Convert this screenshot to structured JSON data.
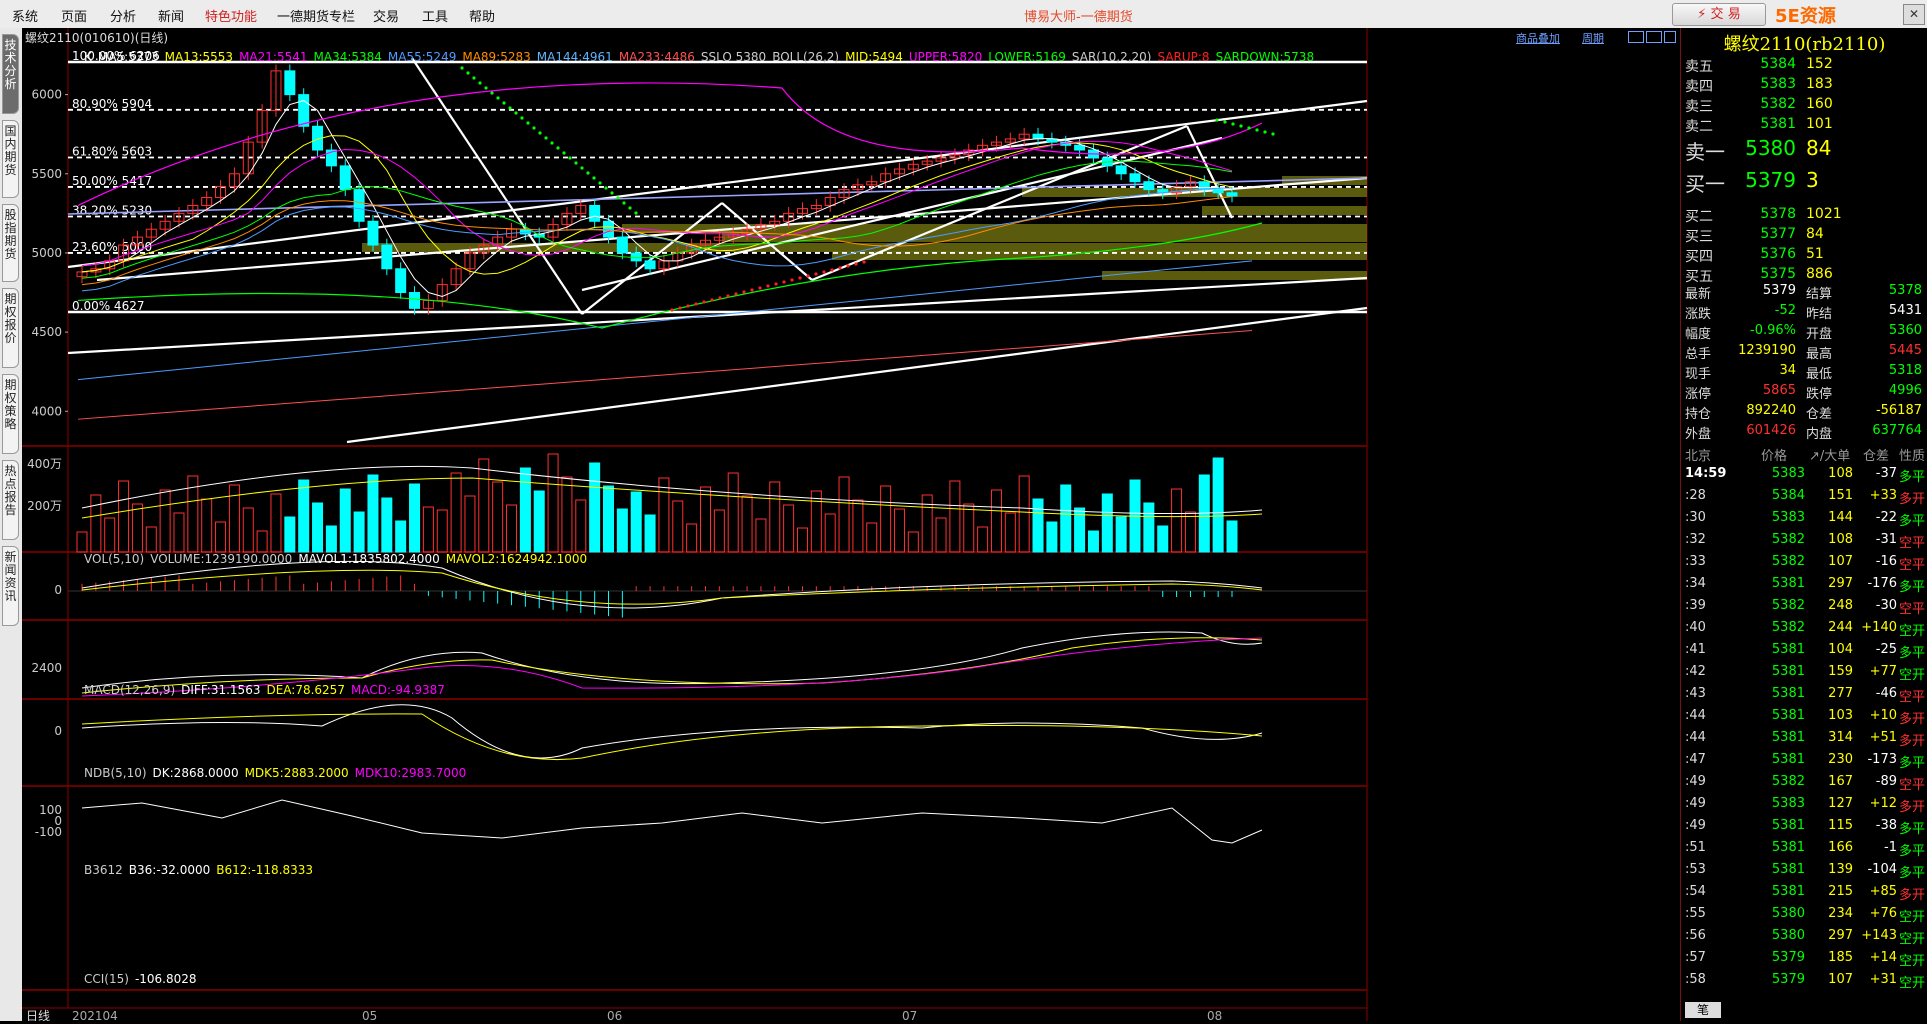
{
  "menu": [
    "系统",
    "页面",
    "分析",
    "新闻",
    "特色功能",
    "一德期货专栏",
    "交易",
    "工具",
    "帮助"
  ],
  "app_title": "博易大师-一德期货",
  "trade_label": "⚡ 交 易",
  "watermark": "5E资源5etz.com",
  "left_tabs": [
    "技术分析",
    "国内期货",
    "股指期货",
    "期权报价",
    "期权策略",
    "热点报告",
    "新闻资讯"
  ],
  "window_title": "螺纹2110(010610)(日线)",
  "top_links": [
    "商品叠加",
    "周期"
  ],
  "ma_legend": [
    {
      "t": "K",
      "c": "#ffffff"
    },
    {
      "t": "MA5:5373",
      "c": "#ffffff"
    },
    {
      "t": "MA13:5553",
      "c": "#ffff00"
    },
    {
      "t": "MA21:5541",
      "c": "#ff00ff"
    },
    {
      "t": "MA34:5384",
      "c": "#00ff00"
    },
    {
      "t": "MA55:5249",
      "c": "#4f9bff"
    },
    {
      "t": "MA89:5283",
      "c": "#ff8c00"
    },
    {
      "t": "MA144:4961",
      "c": "#5fb4ff"
    },
    {
      "t": "MA233:4486",
      "c": "#ff5050"
    },
    {
      "t": "SSLO 5380",
      "c": "#cccccc"
    },
    {
      "t": "BOLL(26,2)",
      "c": "#cccccc"
    },
    {
      "t": "MID:5494",
      "c": "#ffff00"
    },
    {
      "t": "UPPER:5820",
      "c": "#ff00ff"
    },
    {
      "t": "LOWER:5169",
      "c": "#00ff00"
    },
    {
      "t": "SAR(10,2,20)",
      "c": "#cccccc"
    },
    {
      "t": "SARUP:8",
      "c": "#ff2020"
    },
    {
      "t": "SARDOWN:5738",
      "c": "#00ff00"
    }
  ],
  "fib_labels": [
    "100.00% 6206",
    "80.90% 5904",
    "61.80% 5603",
    "50.00% 5417",
    "38.20% 5230",
    "23.60% 5000",
    "0.00% 4627"
  ],
  "price_axis": [
    "6000",
    "5500",
    "5000",
    "4500",
    "4000"
  ],
  "vol_legend": [
    {
      "t": "VOL(5,10)",
      "c": "#cccccc"
    },
    {
      "t": "VOLUME:1239190.0000",
      "c": "#cccccc"
    },
    {
      "t": "MAVOL1:1835802.4000",
      "c": "#ffffff"
    },
    {
      "t": "MAVOL2:1624942.1000",
      "c": "#ffff00"
    }
  ],
  "vol_axis": [
    "400万",
    "200万"
  ],
  "macd_legend": [
    {
      "t": "MACD(12,26,9)",
      "c": "#cccccc"
    },
    {
      "t": "DIFF:31.1563",
      "c": "#ffffff"
    },
    {
      "t": "DEA:78.6257",
      "c": "#ffff00"
    },
    {
      "t": "MACD:-94.9387",
      "c": "#ff00ff"
    }
  ],
  "macd_axis": [
    "0"
  ],
  "ndb_legend": [
    {
      "t": "NDB(5,10)",
      "c": "#cccccc"
    },
    {
      "t": "DK:2868.0000",
      "c": "#ffffff"
    },
    {
      "t": "MDK5:2883.2000",
      "c": "#ffff00"
    },
    {
      "t": "MDK10:2983.7000",
      "c": "#ff00ff"
    }
  ],
  "ndb_axis": [
    "2400"
  ],
  "b36_legend": [
    {
      "t": "B3612",
      "c": "#cccccc"
    },
    {
      "t": "B36:-32.0000",
      "c": "#ffffff"
    },
    {
      "t": "B612:-118.8333",
      "c": "#ffff00"
    }
  ],
  "b36_axis": [
    "0"
  ],
  "cci_legend": [
    {
      "t": "CCI(15)",
      "c": "#cccccc"
    },
    {
      "t": "-106.8028",
      "c": "#ffffff"
    }
  ],
  "cci_axis": [
    "100",
    "0",
    "-100"
  ],
  "date_axis": [
    "日线",
    "202104",
    "05",
    "06",
    "07",
    "08"
  ],
  "quote": {
    "title": "螺纹2110(rb2110)",
    "asks": [
      [
        "卖五",
        "5384",
        "152"
      ],
      [
        "卖四",
        "5383",
        "183"
      ],
      [
        "卖三",
        "5382",
        "160"
      ],
      [
        "卖二",
        "5381",
        "101"
      ],
      [
        "卖一",
        "5380",
        "84"
      ]
    ],
    "bids": [
      [
        "买一",
        "5379",
        "3"
      ],
      [
        "买二",
        "5378",
        "1021"
      ],
      [
        "买三",
        "5377",
        "84"
      ],
      [
        "买四",
        "5376",
        "51"
      ],
      [
        "买五",
        "5375",
        "886"
      ]
    ],
    "stats": [
      [
        "最新",
        "5379",
        "结算",
        "5378"
      ],
      [
        "涨跌",
        "-52",
        "昨结",
        "5431"
      ],
      [
        "幅度",
        "-0.96%",
        "开盘",
        "5360"
      ],
      [
        "总手",
        "1239190",
        "最高",
        "5445"
      ],
      [
        "现手",
        "34",
        "最低",
        "5318"
      ],
      [
        "涨停",
        "5865",
        "跌停",
        "4996"
      ],
      [
        "持仓",
        "892240",
        "仓差",
        "-56187"
      ],
      [
        "外盘",
        "601426",
        "内盘",
        "637764"
      ]
    ],
    "tick_header": [
      "北京",
      "价格",
      "↗/大单",
      "仓差",
      "性质"
    ],
    "ticks": [
      [
        "14:59",
        "5383",
        "108",
        "-37",
        "多平"
      ],
      [
        ":28",
        "5384",
        "151",
        "+33",
        "多开"
      ],
      [
        ":30",
        "5383",
        "144",
        "-22",
        "多平"
      ],
      [
        ":32",
        "5382",
        "108",
        "-31",
        "空平"
      ],
      [
        ":33",
        "5382",
        "107",
        "-16",
        "空平"
      ],
      [
        ":34",
        "5381",
        "297",
        "-176",
        "多平"
      ],
      [
        ":39",
        "5382",
        "248",
        "-30",
        "空平"
      ],
      [
        ":40",
        "5382",
        "244",
        "+140",
        "空开"
      ],
      [
        ":41",
        "5381",
        "104",
        "-25",
        "多平"
      ],
      [
        ":42",
        "5381",
        "159",
        "+77",
        "空开"
      ],
      [
        ":43",
        "5381",
        "277",
        "-46",
        "空平"
      ],
      [
        ":44",
        "5381",
        "103",
        "+10",
        "多开"
      ],
      [
        ":44",
        "5381",
        "314",
        "+51",
        "多开"
      ],
      [
        ":47",
        "5381",
        "230",
        "-173",
        "多平"
      ],
      [
        ":49",
        "5382",
        "167",
        "-89",
        "空平"
      ],
      [
        ":49",
        "5383",
        "127",
        "+12",
        "多开"
      ],
      [
        ":49",
        "5381",
        "115",
        "-38",
        "多平"
      ],
      [
        ":51",
        "5381",
        "166",
        "-1",
        "多平"
      ],
      [
        ":53",
        "5381",
        "139",
        "-104",
        "多平"
      ],
      [
        ":54",
        "5381",
        "215",
        "+85",
        "多开"
      ],
      [
        ":55",
        "5380",
        "234",
        "+76",
        "空开"
      ],
      [
        ":56",
        "5380",
        "297",
        "+143",
        "空开"
      ],
      [
        ":57",
        "5379",
        "185",
        "+14",
        "空开"
      ],
      [
        ":58",
        "5379",
        "107",
        "+31",
        "空开"
      ]
    ],
    "bottom_tab": "笔"
  },
  "colors": {
    "up": "#ff3030",
    "down": "#00ffff",
    "panel_border": "#8b0000",
    "fib": "#ffffff",
    "olive": "#6b6b0f"
  }
}
